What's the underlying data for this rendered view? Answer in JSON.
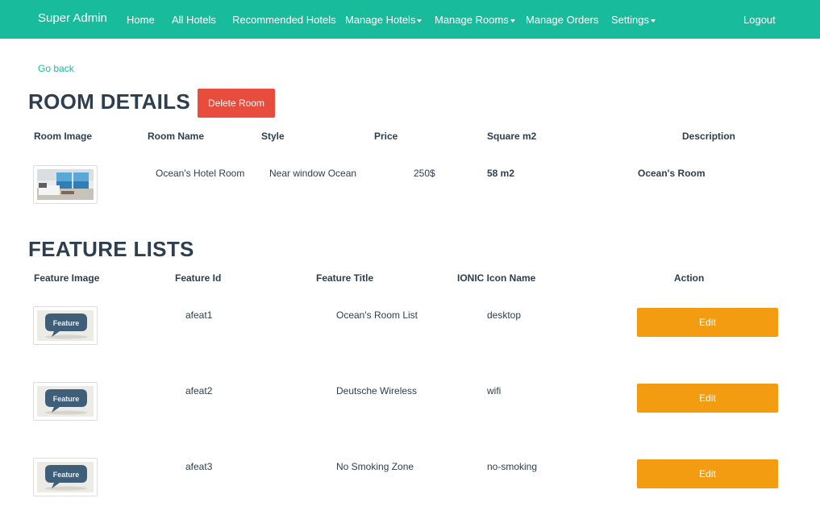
{
  "navbar": {
    "brand": "Super Admin",
    "links": [
      "Home",
      "All Hotels",
      "Recommended Hotels",
      "Manage Hotels",
      "Manage Rooms",
      "Manage Orders",
      "Settings"
    ],
    "logout": "Logout"
  },
  "go_back": "Go back",
  "room_details": {
    "title": "ROOM DETAILS",
    "delete_label": "Delete Room",
    "headers": [
      "Room Image",
      "Room Name",
      "Style",
      "Price",
      "Square m2",
      "Description"
    ],
    "row": {
      "name": "Ocean's Hotel Room",
      "style": "Near window Ocean",
      "price": "250$",
      "square": "58 m2",
      "description": "Ocean's Room"
    }
  },
  "features": {
    "title": "FEATURE LISTS",
    "headers": [
      "Feature Image",
      "Feature Id",
      "Feature Title",
      "IONIC Icon Name",
      "Action"
    ],
    "image_text": "Feature",
    "rows": [
      {
        "id": "afeat1",
        "title": "Ocean's Room List",
        "icon_name": "desktop",
        "action": "Edit"
      },
      {
        "id": "afeat2",
        "title": "Deutsche Wireless",
        "icon_name": "wifi",
        "action": "Edit"
      },
      {
        "id": "afeat3",
        "title": "No Smoking Zone",
        "icon_name": "no-smoking",
        "action": "Edit"
      }
    ]
  },
  "colors": {
    "navbar": "#18bc9c",
    "danger": "#e74c3c",
    "warning": "#f39c12",
    "text": "#2c3e50"
  }
}
